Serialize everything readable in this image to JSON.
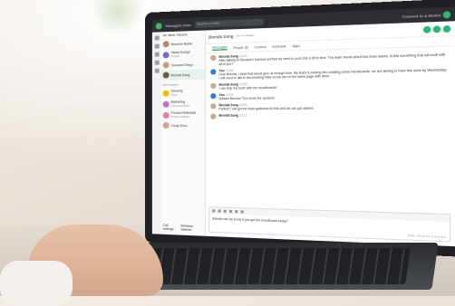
{
  "app": {
    "search_placeholder": "Search or enter",
    "right_status": "Connect to a device",
    "current_user": "Managers team"
  },
  "sidebar": {
    "filters": [
      "All",
      "Mute",
      "Recent"
    ],
    "contacts": [
      {
        "name": "Brandon Burke",
        "sub": "",
        "color": "#b58a6c"
      },
      {
        "name": "Intelia Design",
        "sub": "Project",
        "color": "#7a6bc0"
      },
      {
        "name": "Giovanni Diego",
        "sub": "",
        "color": "#c9a07e"
      },
      {
        "name": "Brenda Song",
        "sub": "",
        "color": "#6d5a4a",
        "selected": true
      }
    ],
    "section_label": "More spaces",
    "spaces": [
      {
        "name": "Dancing",
        "sub": "Team",
        "color": "#e6c300"
      },
      {
        "name": "Marketing",
        "sub": "Communication",
        "color": "#c16fd1"
      },
      {
        "name": "Product Materials",
        "sub": "Project updates",
        "color": "#e67ea0"
      },
      {
        "name": "Cindy Zhou",
        "sub": "",
        "color": "#c8a98f"
      }
    ],
    "footer": [
      "Call settings",
      "Wireless Internet"
    ]
  },
  "conversation": {
    "title": "Brenda Song",
    "subtitle": "Do not disturb",
    "tabs": [
      "Messages",
      "People (5)",
      "Content",
      "Schedule",
      "Apps"
    ],
    "messages": [
      {
        "name": "Brenda Song",
        "time": "13:00",
        "text": "After talking to Giovanni I learned out that we need to push this a bit in time. The team needs about two more weeks. Is this something that will work with all of you?"
      },
      {
        "name": "You",
        "time": "13:08",
        "text": "Dear Brenda, I think that would give us enough time. My team is looking into creating some moodboards, we are aiming to have this done by Wednesday. I will need to talk to the branding folks on we are on the same page with them."
      },
      {
        "name": "Brenda Song",
        "time": "13:08",
        "text": "I can help the team with the moodboards!"
      },
      {
        "name": "You",
        "time": "13:09",
        "text": "Brilliant Brenda! This move the revision!"
      },
      {
        "name": "Brenda Song",
        "time": "13:09",
        "text": "Perfect! I will get the team gathered for this and we can get started."
      },
      {
        "name": "Brenda Song",
        "time": "13:11",
        "text": ""
      }
    ],
    "compose_text": "Brenda can we know if you got the moodboard today?",
    "compose_hint": "Shift + Enter for a new line"
  }
}
